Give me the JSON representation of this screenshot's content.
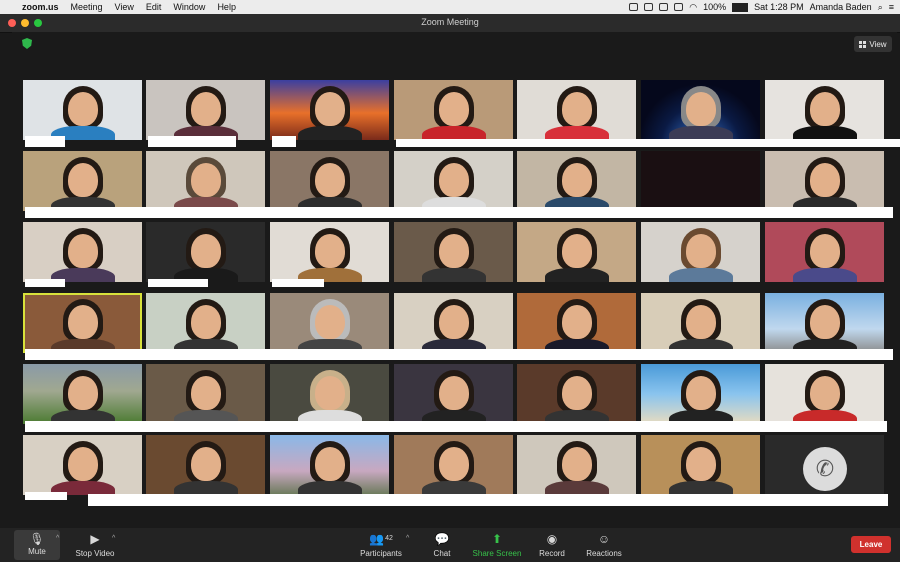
{
  "menubar": {
    "app": "zoom.us",
    "items": [
      "Meeting",
      "View",
      "Edit",
      "Window",
      "Help"
    ],
    "battery": "100%",
    "clock": "Sat 1:28 PM",
    "user": "Amanda Baden"
  },
  "window": {
    "title": "Zoom Meeting"
  },
  "view_button": {
    "label": "View"
  },
  "participants_count": "42",
  "toolbar": {
    "mute": "Mute",
    "stop_video": "Stop Video",
    "participants": "Participants",
    "chat": "Chat",
    "share_screen": "Share Screen",
    "record": "Record",
    "reactions": "Reactions",
    "leave": "Leave"
  },
  "colors": {
    "accent_green": "#37c14a",
    "leave_red": "#d0312d",
    "active_speaker": "#d8e23b"
  },
  "icons": {
    "security": "shield-icon",
    "mute": "microphone-icon",
    "video": "video-camera-icon",
    "participants": "people-icon",
    "chat": "chat-bubble-icon",
    "share": "share-arrow-icon",
    "record": "record-icon",
    "reactions": "emoji-icon",
    "phone": "phone-icon"
  }
}
